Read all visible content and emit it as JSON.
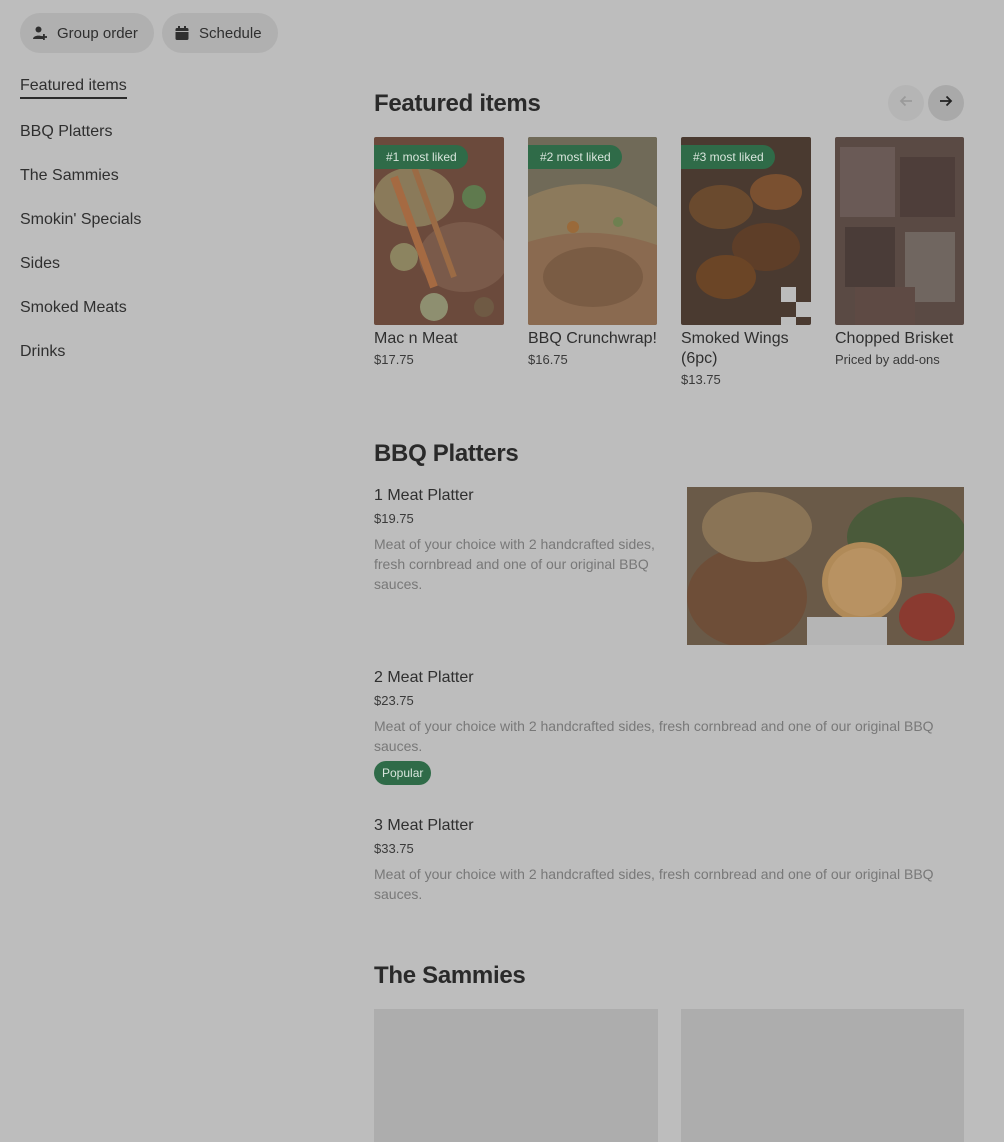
{
  "top_actions": {
    "group_order": "Group order",
    "schedule": "Schedule"
  },
  "sidebar": {
    "items": [
      {
        "label": "Featured items",
        "active": true
      },
      {
        "label": "BBQ Platters"
      },
      {
        "label": "The Sammies"
      },
      {
        "label": "Smokin' Specials"
      },
      {
        "label": "Sides"
      },
      {
        "label": "Smoked Meats"
      },
      {
        "label": "Drinks"
      }
    ]
  },
  "featured": {
    "title": "Featured items",
    "items": [
      {
        "name": "Mac n Meat",
        "price": "$17.75",
        "badge": "#1 most liked"
      },
      {
        "name": "BBQ Crunchwrap!",
        "price": "$16.75",
        "badge": "#2 most liked"
      },
      {
        "name": "Smoked Wings (6pc)",
        "price": "$13.75",
        "badge": "#3 most liked"
      },
      {
        "name": "Chopped Brisket",
        "price": "Priced by add-ons"
      }
    ]
  },
  "platters": {
    "title": "BBQ Platters",
    "items": [
      {
        "name": "1 Meat Platter",
        "price": "$19.75",
        "desc": "Meat of your choice with 2 handcrafted sides, fresh cornbread and one of our original BBQ sauces."
      },
      {
        "name": "2 Meat Platter",
        "price": "$23.75",
        "desc": "Meat of your choice with 2 handcrafted sides, fresh cornbread and one of our original BBQ sauces.",
        "badge": "Popular"
      },
      {
        "name": "3 Meat Platter",
        "price": "$33.75",
        "desc": "Meat of your choice with 2 handcrafted sides, fresh cornbread and one of our original BBQ sauces."
      }
    ]
  },
  "sammies": {
    "title": "The Sammies"
  },
  "colors": {
    "overlay_bg": "#bdbdbd",
    "badge_green": "#2f6b48",
    "badge_text": "#d8e5dc"
  },
  "icons": [
    "add-person-icon",
    "calendar-icon",
    "arrow-left-icon",
    "arrow-right-icon"
  ]
}
